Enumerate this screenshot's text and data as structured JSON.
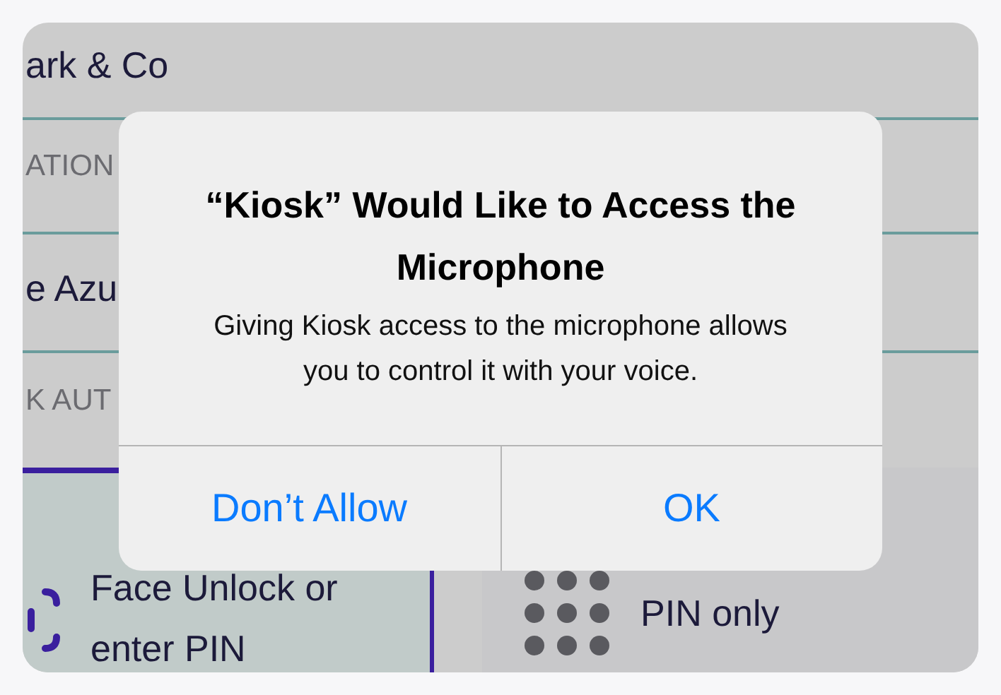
{
  "background": {
    "rows": [
      {
        "kind": "item",
        "text": "ark & Co"
      },
      {
        "kind": "header",
        "text": "ATION"
      },
      {
        "kind": "item",
        "text": "e Azu"
      },
      {
        "kind": "header",
        "text": "K AUT"
      }
    ],
    "options": [
      {
        "kind": "face",
        "label": "Face Unlock or enter PIN",
        "selected": true
      },
      {
        "kind": "pin",
        "label": "PIN only",
        "selected": false
      }
    ]
  },
  "alert": {
    "title": "“Kiosk” Would Like to Access the Microphone",
    "message": "Giving Kiosk access to the microphone allows you to control it with your voice.",
    "buttons": [
      {
        "label": "Don’t Allow"
      },
      {
        "label": "OK"
      }
    ]
  }
}
